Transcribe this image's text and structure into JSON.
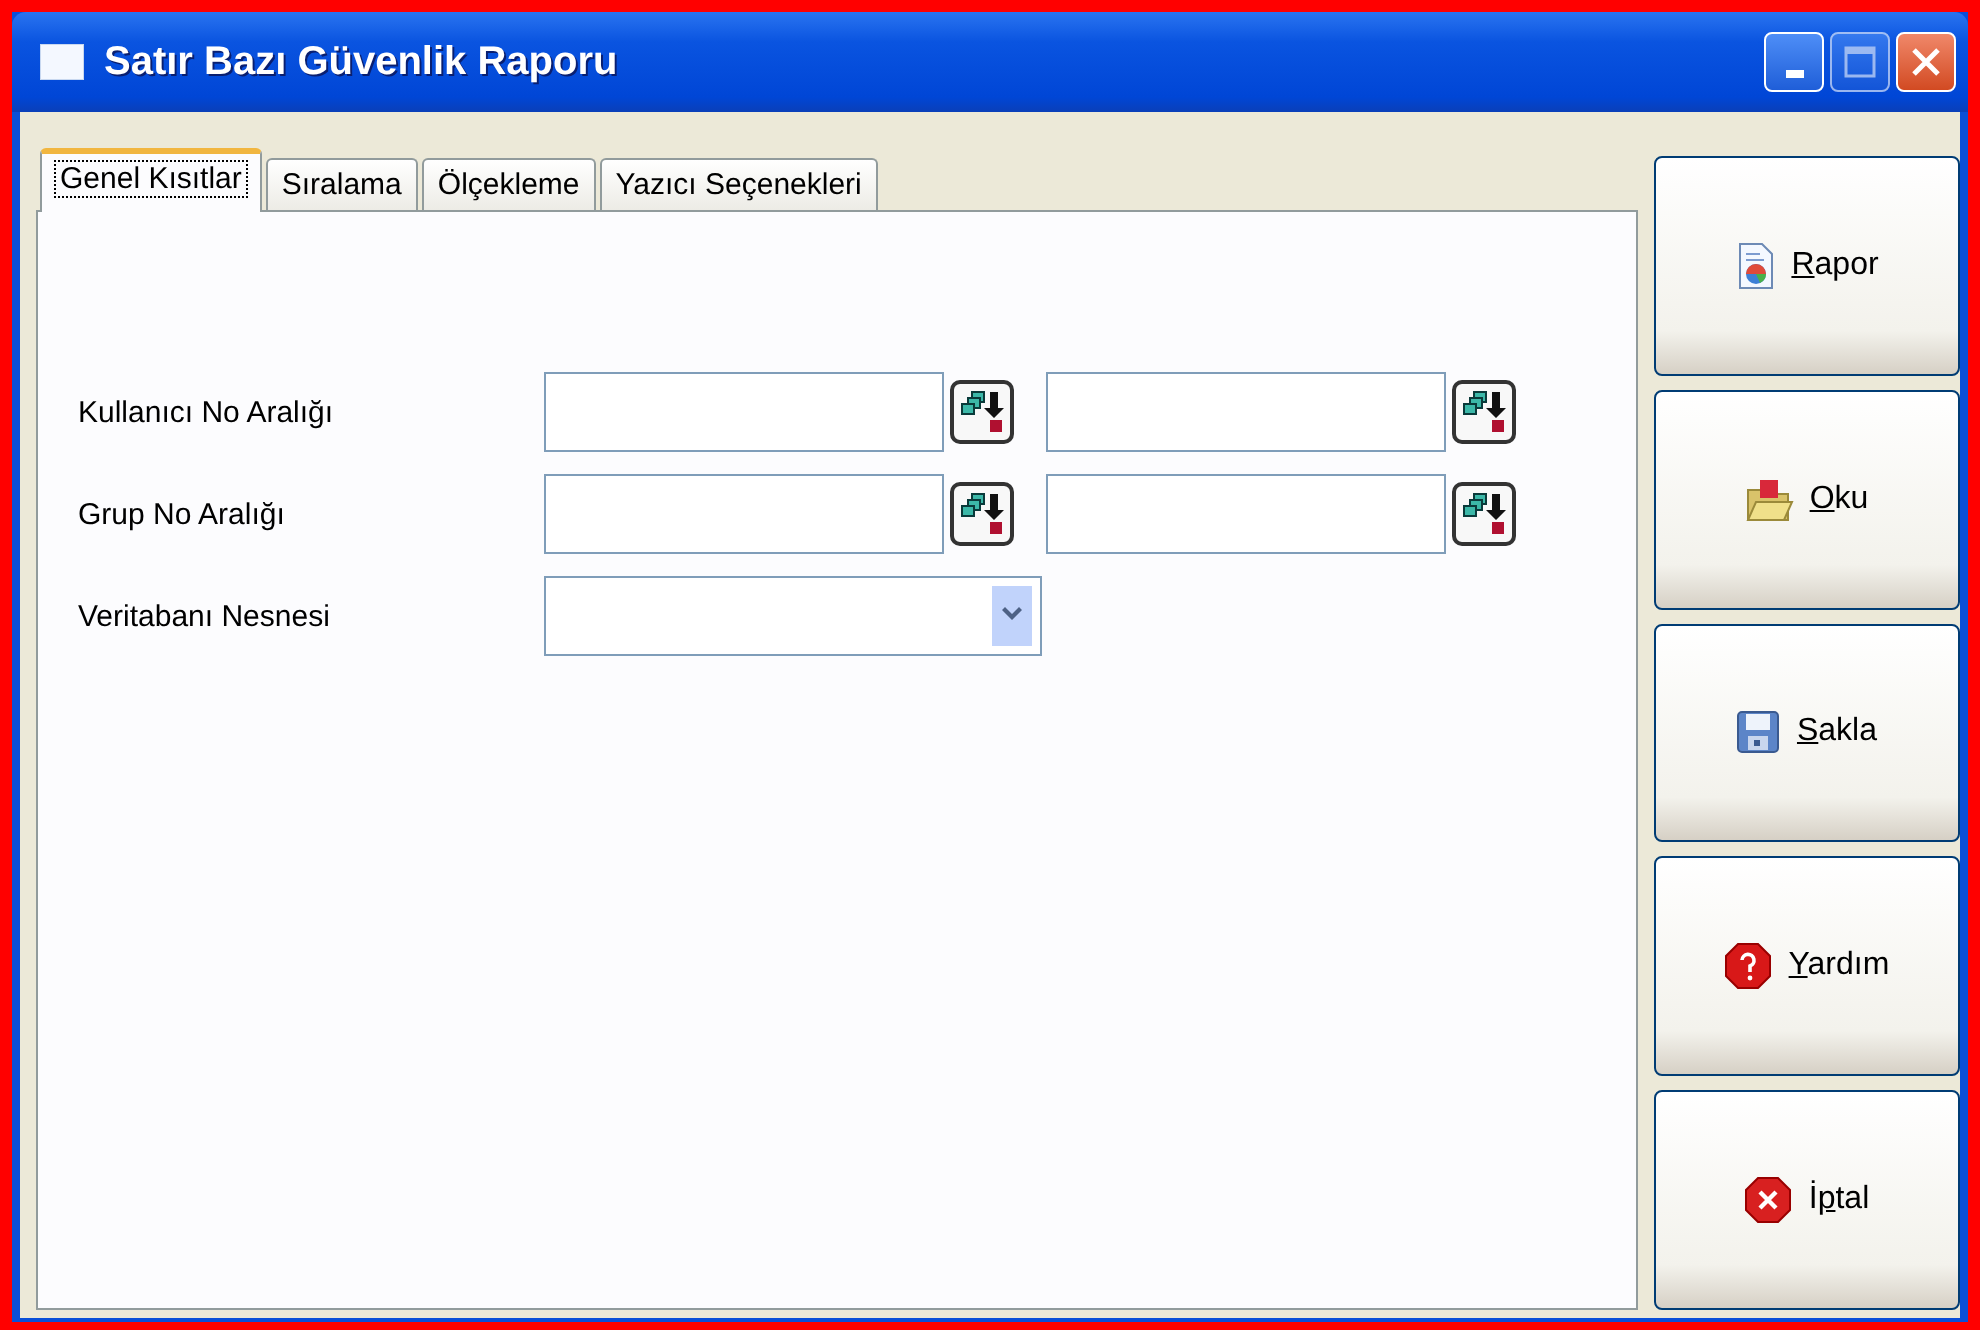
{
  "window": {
    "title": "Satır Bazı Güvenlik Raporu"
  },
  "tabs": [
    {
      "label": "Genel Kısıtlar",
      "selected": true
    },
    {
      "label": "Sıralama",
      "selected": false
    },
    {
      "label": "Ölçekleme",
      "selected": false
    },
    {
      "label": "Yazıcı Seçenekleri",
      "selected": false
    }
  ],
  "fields": [
    {
      "label": "Kullanıcı No Aralığı",
      "kind": "range"
    },
    {
      "label": "Grup No Aralığı",
      "kind": "range"
    },
    {
      "label": "Veritabanı Nesnesi",
      "kind": "dropdown"
    }
  ],
  "buttons": [
    {
      "kind": "report",
      "key": "R",
      "after": "apor"
    },
    {
      "kind": "open",
      "key": "O",
      "after": "ku"
    },
    {
      "kind": "save",
      "key": "S",
      "after": "akla"
    },
    {
      "kind": "help",
      "key": "Y",
      "after": "ardım"
    },
    {
      "kind": "cancel",
      "before": "İ",
      "key": "p",
      "after": "tal"
    }
  ]
}
